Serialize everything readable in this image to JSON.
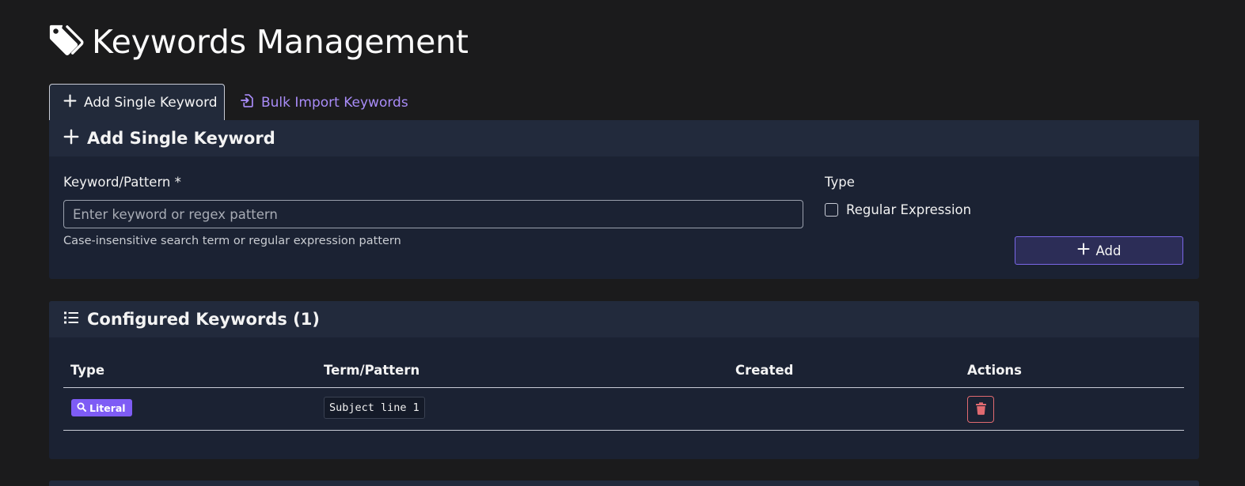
{
  "header": {
    "title": "Keywords Management",
    "icon": "tags-icon"
  },
  "tabs": [
    {
      "label": "Add Single Keyword",
      "icon": "plus-icon",
      "active": true
    },
    {
      "label": "Bulk Import Keywords",
      "icon": "file-import-icon",
      "active": false
    }
  ],
  "add_card": {
    "title": "Add Single Keyword",
    "keyword_label": "Keyword/Pattern *",
    "keyword_value": "",
    "keyword_placeholder": "Enter keyword or regex pattern",
    "help_text": "Case-insensitive search term or regular expression pattern",
    "type_label": "Type",
    "regex_label": "Regular Expression",
    "regex_checked": false,
    "add_button_label": "Add"
  },
  "keywords_card": {
    "title": "Configured Keywords (1)",
    "columns": [
      "Type",
      "Term/Pattern",
      "Created",
      "Actions"
    ],
    "rows": [
      {
        "type": "Literal",
        "term": "Subject line 1",
        "created": ""
      }
    ]
  },
  "colors": {
    "accent": "#7e5cf5",
    "tab_link": "#a98cf8",
    "danger": "#e06a70",
    "card_bg": "#1b2233",
    "page_bg": "#1b1b1c"
  }
}
